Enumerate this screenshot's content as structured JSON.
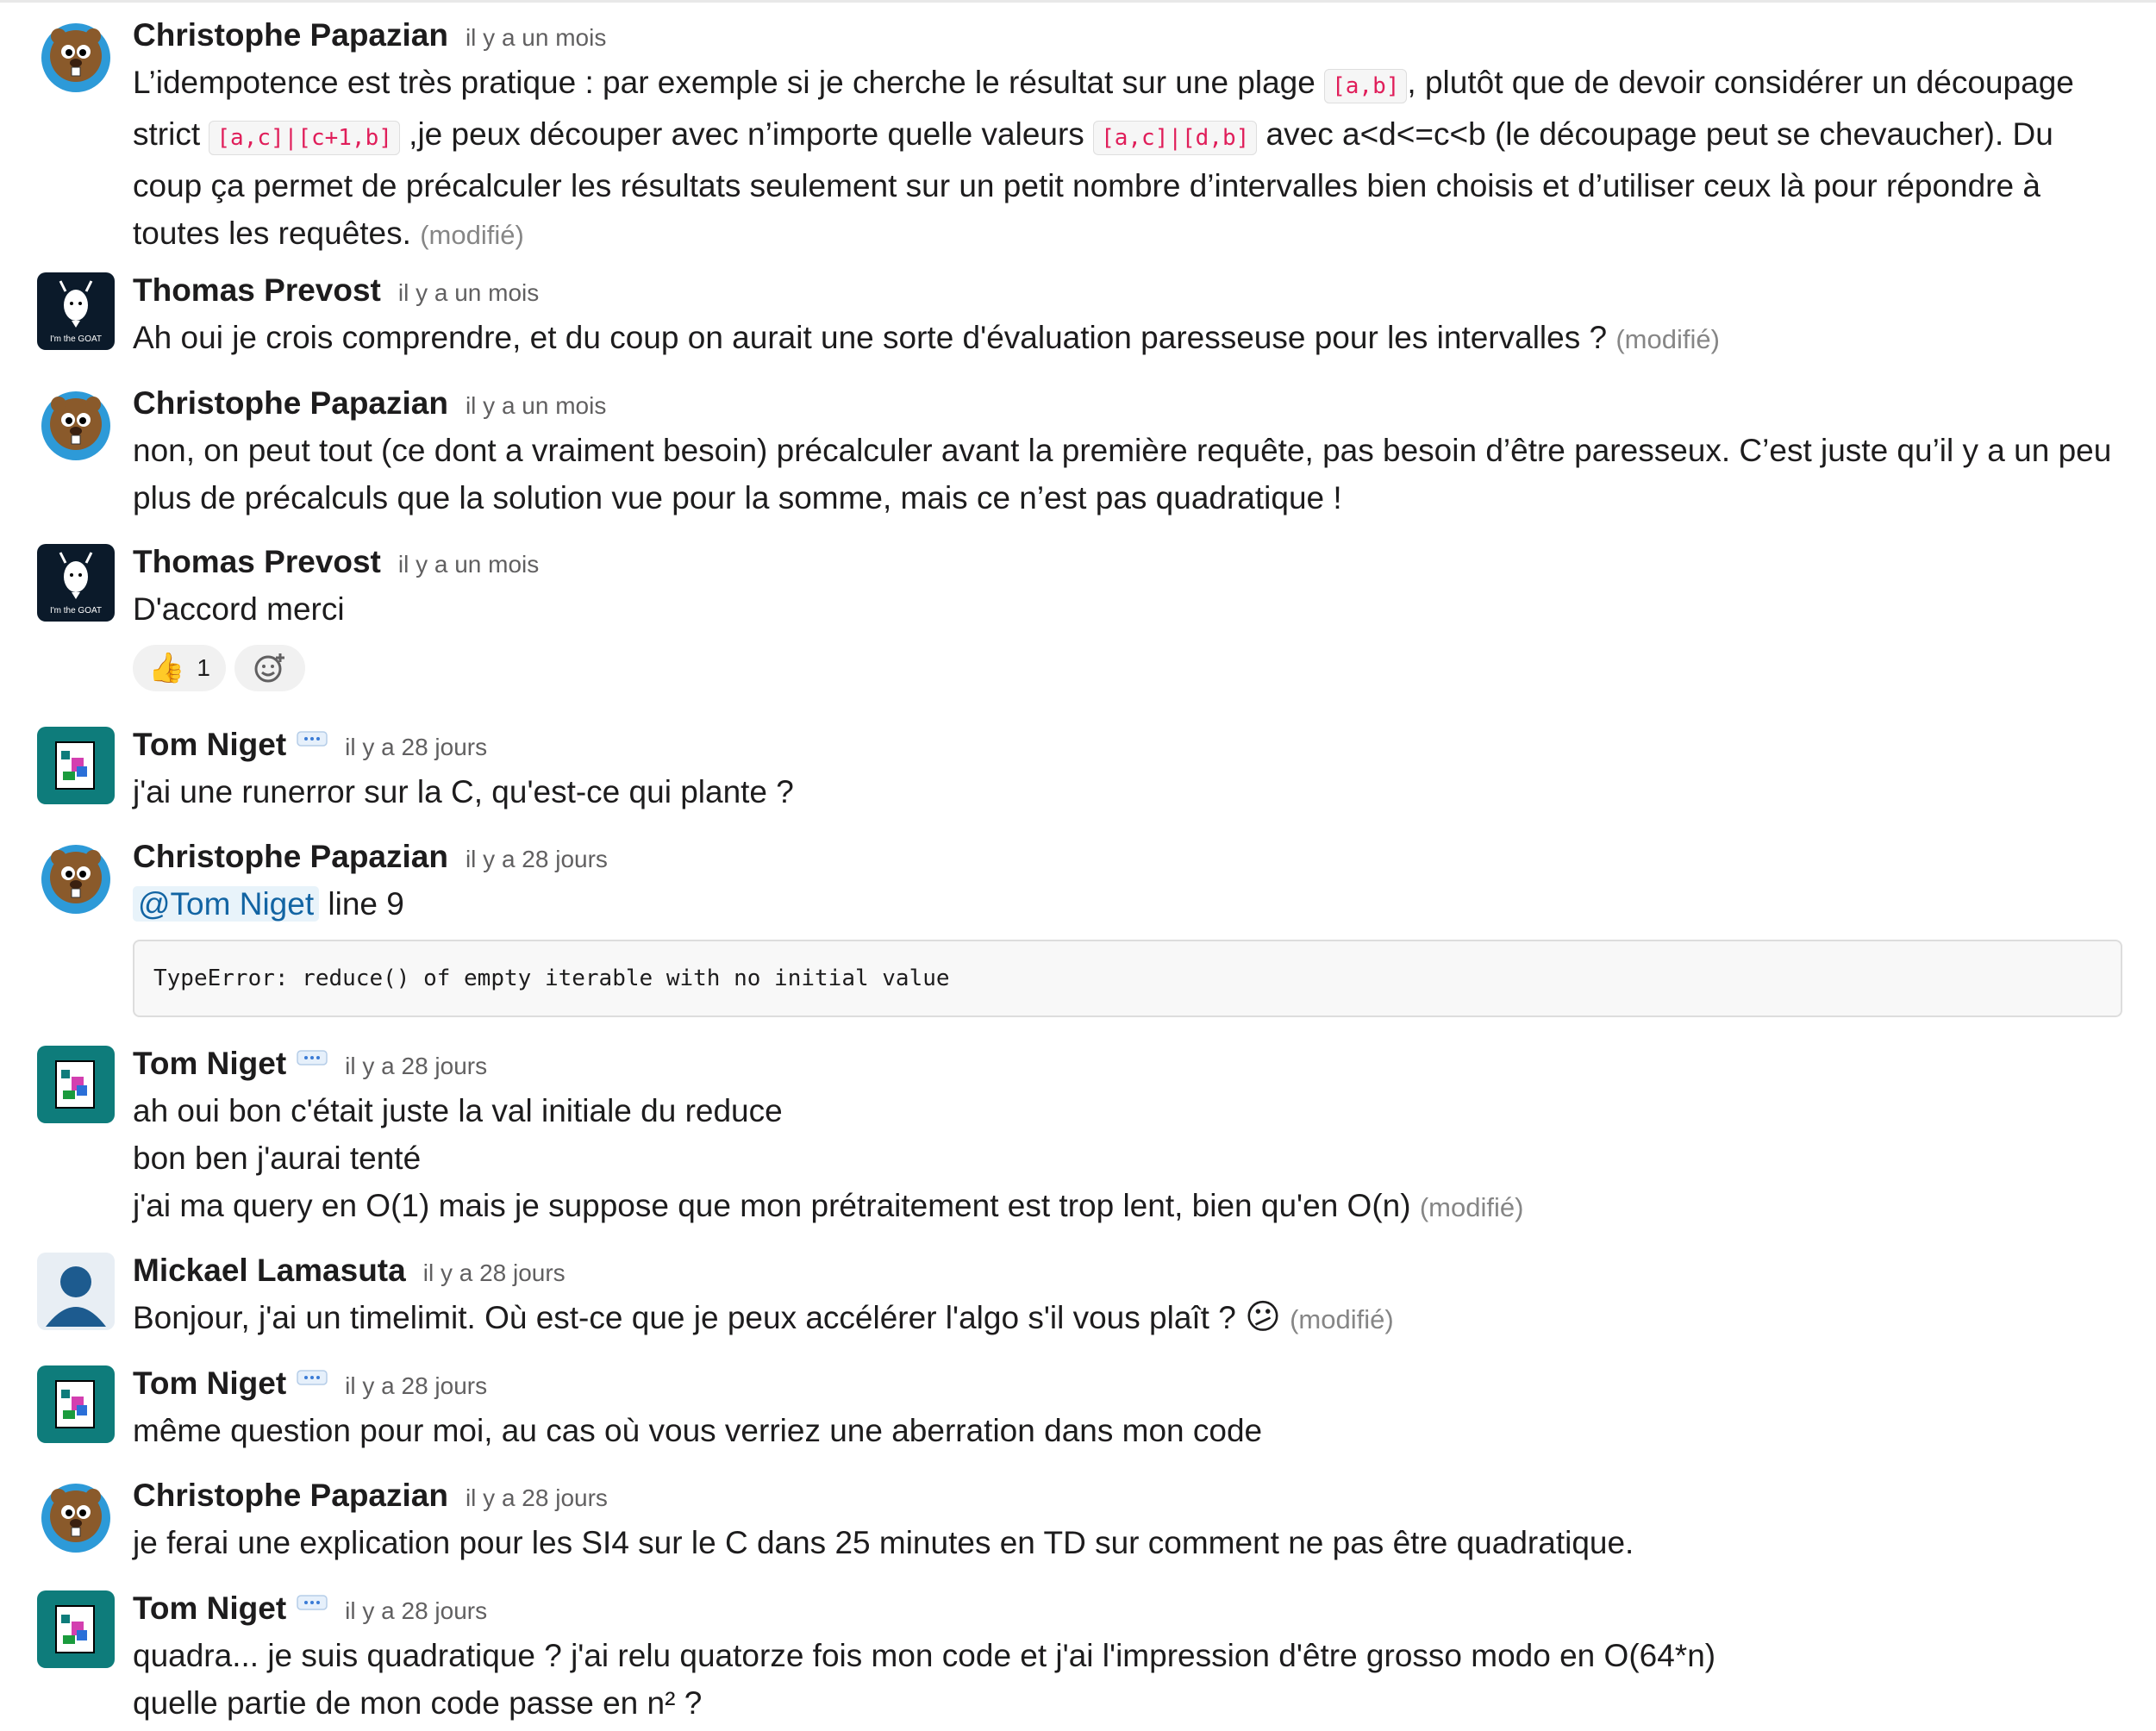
{
  "messages": [
    {
      "author": "Christophe Papazian",
      "time": "il y a un mois",
      "parts": {
        "p1": "L’idempotence est très pratique : par exemple si je cherche le résultat sur une plage ",
        "c1": "[a,b]",
        "p2": ", plutôt que de devoir considérer un découpage",
        "p3": "strict ",
        "c2": "[a,c]|[c+1,b]",
        "p4": " ,je peux découper avec n’importe quelle valeurs ",
        "c3": "[a,c]|[d,b]",
        "p5": "  avec a<d<=c<b (le découpage peut se chevaucher). Du",
        "p6": "coup ça permet de précalculer les résultats seulement sur un petit nombre d’intervalles bien choisis et d’utiliser ceux là pour répondre à",
        "p7": "toutes les requêtes."
      },
      "edited": "(modifié)"
    },
    {
      "author": "Thomas Prevost",
      "time": "il y a un mois",
      "text": "Ah oui je crois comprendre, et du coup on aurait une sorte d'évaluation paresseuse pour les intervalles ?",
      "edited": "(modifié)"
    },
    {
      "author": "Christophe Papazian",
      "time": "il y a un mois",
      "line1": "non, on peut tout (ce dont a vraiment besoin) précalculer avant la première requête, pas besoin d’être paresseux.  C’est juste qu’il y a un peu",
      "line2": "plus de précalculs que la solution vue pour la somme, mais ce n’est pas quadratique !"
    },
    {
      "author": "Thomas Prevost",
      "time": "il y a un mois",
      "text": "D'accord merci",
      "reaction_emoji": "👍",
      "reaction_count": "1",
      "add_reaction_icon": "add-emoji-icon"
    },
    {
      "author": "Tom Niget",
      "time": "il y a 28 jours",
      "text": "j'ai une runerror sur la C, qu'est-ce qui plante ?"
    },
    {
      "author": "Christophe Papazian",
      "time": "il y a 28 jours",
      "mention": "@Tom Niget",
      "text": " line 9",
      "code_block": "TypeError: reduce() of empty iterable with no initial value"
    },
    {
      "author": "Tom Niget",
      "time": "il y a 28 jours",
      "line1": "ah oui bon c'était juste la val initiale du reduce",
      "line2": "bon ben j'aurai tenté",
      "line3": "j'ai ma query en O(1) mais je suppose que mon prétraitement est trop lent, bien qu'en O(n)",
      "edited": "(modifié)"
    },
    {
      "author": "Mickael Lamasuta",
      "time": "il y a 28 jours",
      "text": "Bonjour, j'ai un timelimit. Où est-ce que je peux accélérer l'algo s'il vous plaît ?",
      "emoji": "😕",
      "edited": "(modifié)"
    },
    {
      "author": "Tom Niget",
      "time": "il y a 28 jours",
      "text": "même question pour moi, au cas où vous verriez une aberration dans mon code"
    },
    {
      "author": "Christophe Papazian",
      "time": "il y a 28 jours",
      "text": "je ferai une explication pour les SI4 sur le C dans 25 minutes en TD sur comment ne pas être quadratique."
    },
    {
      "author": "Tom Niget",
      "time": "il y a 28 jours",
      "line1": "quadra... je suis quadratique ? j'ai relu quatorze fois mon code et j'ai l'impression d'être grosso modo en O(64*n)",
      "line2": "quelle partie de mon code passe en n² ?"
    }
  ],
  "avatar_text": {
    "thomas": "I'm the GOAT"
  },
  "colors": {
    "name": "#1d1c1d",
    "time": "#616061",
    "code": "#e01e5a",
    "mention": "#1264a3",
    "teal_avatar": "#0e7c7b",
    "user_avatar": "#1d5b8f"
  }
}
